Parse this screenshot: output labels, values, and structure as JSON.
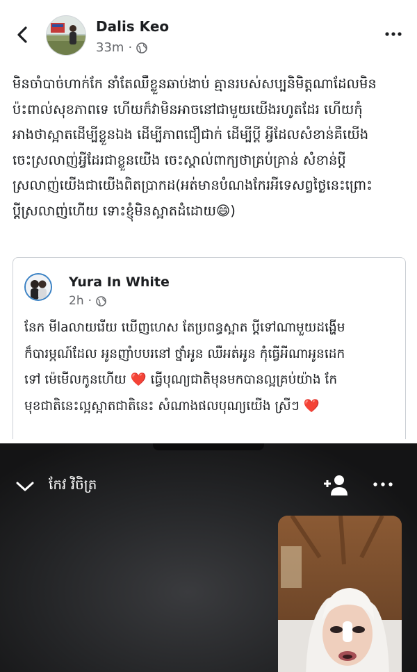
{
  "post": {
    "author": "Dalis Keo",
    "time": "33m",
    "separator": "·",
    "lines": [
      "មិនចាំបាច់ហាក់កែ នាំតែឈឺខ្លួនឆាប់ងាប់ គ្មានរបស់សប្បនិមិត្តណាដែលមិន",
      "ប៉ះពាល់សុខភាពទេ ហើយក៏វាមិនអាចនៅជាមួយយើងរហូតដែរ ហើយកុំ",
      "អាងថាស្អាតដើម្បីខ្លួនឯង ដើម្បីភាពជឿជាក់ ដើម្បីប្តី អ្វីដែលសំខាន់គឺយើង",
      "ចេះស្រលាញ់អ្វីដែរជាខ្លួនយើង ចេះស្គាល់ពាក្យថាគ្រប់គ្រាន់ សំខាន់ប្តី",
      "ស្រលាញ់យើងជាយើងពិតប្រាកដ(អត់មានបំណងកែរអីទេសព្វថ្ងៃនេះព្រោះ",
      "ប្តីស្រលាញ់ហើយ ទោះខ្ញុំមិនស្អាតដំដោយ😄)"
    ]
  },
  "shared": {
    "author": "Yura In White",
    "time": "2h",
    "separator": "·",
    "lines": [
      "នែក មីlaលាយរើយ ឃើញហេស តែប្រពន្ធស្អាត ប្តីទៅណាមួយដង្ហើម",
      "ក៏បារម្ភណ៍ដែល អូនញាំបបរនៅ ថ្នាំអូន ឈឺអត់អូន កុំធ្វើអីណាអូនដេក",
      "ទៅ ម៉េមើលកូនហើយ ❤️ ធ្វើបុណ្យជាតិមុនមកបានល្អគ្រប់យ៉ាង កែ",
      "មុខជាតិនេះល្អស្អាតជាតិនេះ សំណាងផលបុណ្យយើង ស្រីៗ ❤️"
    ]
  },
  "video": {
    "title": "កែវ វិចិត្រ"
  },
  "icons": {
    "back": "back-arrow-icon",
    "globe": "globe-icon",
    "more": "more-horizontal-icon",
    "chevron": "chevron-down-icon",
    "add_person": "add-person-icon"
  },
  "colors": {
    "text": "#1c1e21",
    "meta": "#65676b",
    "heart": "#e02424",
    "video_bg": "#161617"
  }
}
